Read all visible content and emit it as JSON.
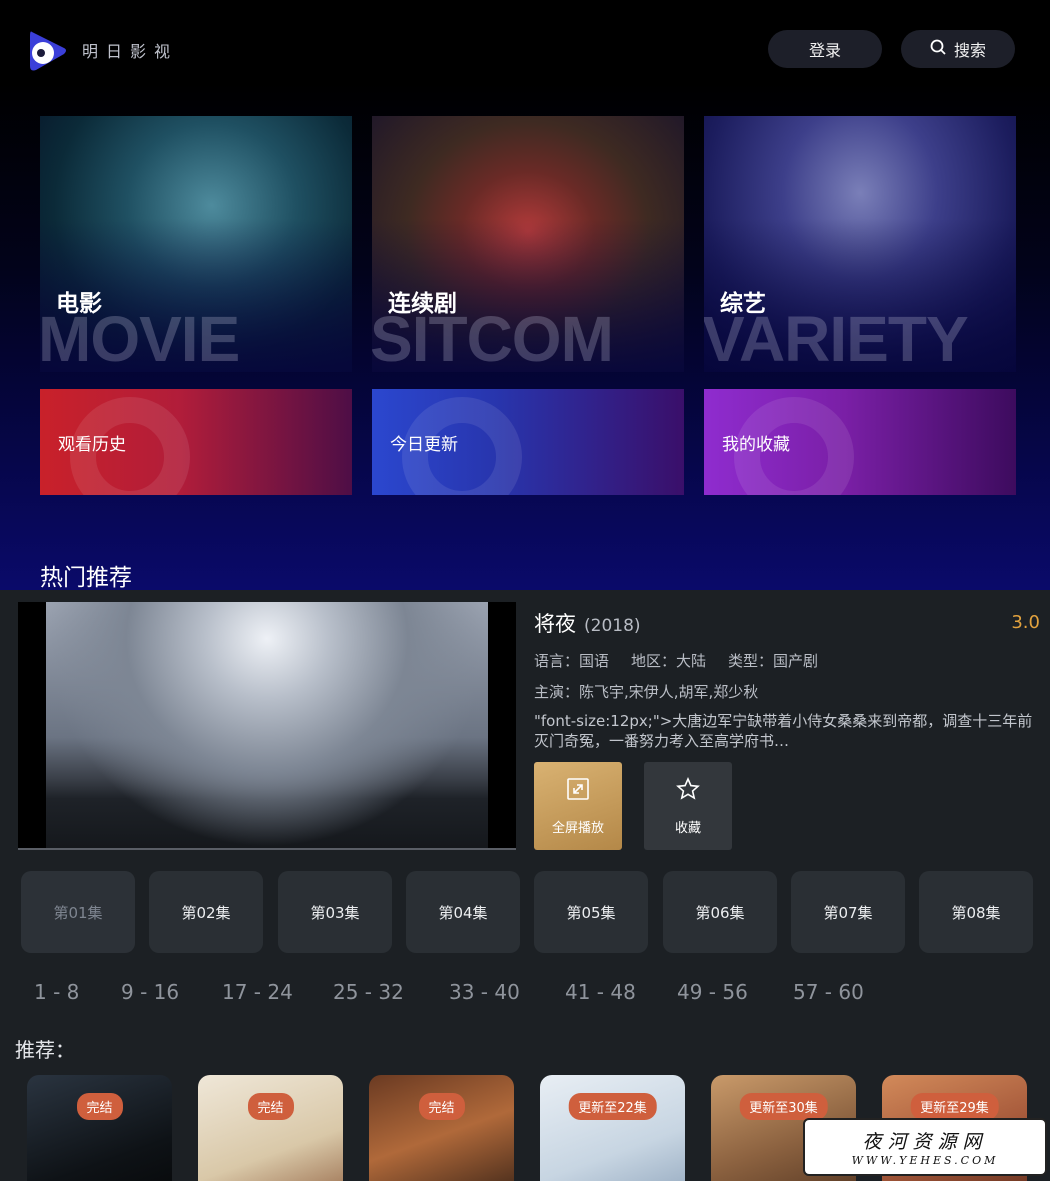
{
  "header": {
    "brand": "明日影视",
    "login_label": "登录",
    "search_label": "搜索"
  },
  "categories": [
    {
      "cn": "电影",
      "en": "MOVIE"
    },
    {
      "cn": "连续剧",
      "en": "SITCOM"
    },
    {
      "cn": "综艺",
      "en": "VARIETY"
    }
  ],
  "quick_links": [
    "观看历史",
    "今日更新",
    "我的收藏"
  ],
  "hot": {
    "section_title": "热门推荐",
    "title": "将夜",
    "year": "(2018)",
    "rating": "3.0",
    "language": "语言：国语",
    "region": "地区：大陆",
    "genre": "类型：国产剧",
    "cast": "主演：陈飞宇,宋伊人,胡军,郑少秋",
    "description": "\"font-size:12px;\">大唐边军宁缺带着小侍女桑桑来到帝都，调查十三年前灭门奇冤，一番努力考入至高学府书…",
    "fullscreen_label": "全屏播放",
    "collect_label": "收藏"
  },
  "episodes": [
    "第01集",
    "第02集",
    "第03集",
    "第04集",
    "第05集",
    "第06集",
    "第07集",
    "第08集"
  ],
  "ranges": [
    "1 - 8",
    "9 - 16",
    "17 - 24",
    "25 - 32",
    "33 - 40",
    "41 - 48",
    "49 - 56",
    "57 - 60"
  ],
  "recommend": {
    "title": "推荐：",
    "items": [
      {
        "badge": "完结"
      },
      {
        "badge": "完结"
      },
      {
        "badge": "完结"
      },
      {
        "badge": "更新至22集"
      },
      {
        "badge": "更新至30集"
      },
      {
        "badge": "更新至29集"
      }
    ]
  },
  "watermark": {
    "cn": "夜河资源网",
    "en": "WWW.YEHES.COM"
  }
}
